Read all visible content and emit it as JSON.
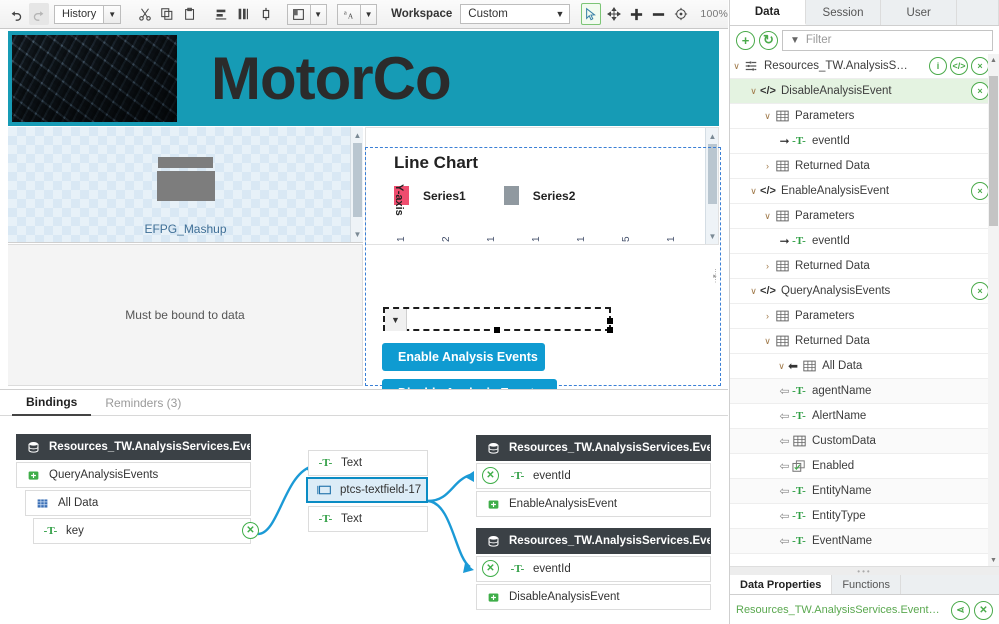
{
  "toolbar": {
    "undo": "undo-arrow",
    "redo": "redo-arrow",
    "history_label": "History",
    "cut": "scissors-icon",
    "copy": "copy-icon",
    "paste": "paste-icon",
    "align_h": "align-horizontal-icon",
    "align_v": "align-vertical-icon",
    "distribute": "distribute-icon",
    "layout": "layout-icon",
    "style": "style-text-icon",
    "workspace_label": "Workspace",
    "workspace_value": "Custom",
    "select_tool": "cursor-select-icon",
    "pan_tool": "pan-move-icon",
    "zoom_in": "plus-icon",
    "zoom_out": "minus-icon",
    "zoom_reset": "target-icon",
    "zoom_level": "100%"
  },
  "canvas": {
    "header_title": "MotorCo",
    "header_image": "engine-photo",
    "mashup_label": "EFPG_Mashup",
    "bound_placeholder": "Must be bound to data",
    "chart": {
      "title": "Line Chart",
      "legend": [
        {
          "label": "Series1",
          "color": "#ef4d6f"
        },
        {
          "label": "Series2",
          "color": "#9099a0"
        }
      ],
      "ylabel": "Y-axis",
      "xticks": [
        "1",
        "2",
        "1",
        "1",
        "1",
        "5",
        "1"
      ]
    },
    "dropdown_value": "",
    "buttons": [
      {
        "label": "Enable Analysis Events"
      },
      {
        "label": "Disable Analysis Events"
      }
    ]
  },
  "bindings": {
    "tabs": [
      {
        "label": "Bindings",
        "active": true
      },
      {
        "label": "Reminders (3)",
        "active": false
      }
    ],
    "left_group": [
      {
        "label": "Resources_TW.AnalysisServices.EventManagem...",
        "icon": "database-icon",
        "style": "dark"
      },
      {
        "label": "QueryAnalysisEvents",
        "icon": "service-icon",
        "style": "plain"
      },
      {
        "label": "All Data",
        "icon": "table-icon",
        "style": "plain"
      },
      {
        "label": "key",
        "icon": "text-type-icon",
        "style": "plain"
      }
    ],
    "middle_group": [
      {
        "label": "Text",
        "icon": "text-type-icon",
        "style": "plain"
      },
      {
        "label": "ptcs-textfield-17",
        "icon": "textfield-icon",
        "style": "sel"
      },
      {
        "label": "Text",
        "icon": "text-type-icon",
        "style": "plain"
      }
    ],
    "right_group_1": [
      {
        "label": "Resources_TW.AnalysisServices.EventManagem...",
        "icon": "database-icon",
        "style": "dark"
      },
      {
        "label": "eventId",
        "icon": "text-type-icon",
        "style": "plain"
      },
      {
        "label": "EnableAnalysisEvent",
        "icon": "service-icon",
        "style": "plain"
      }
    ],
    "right_group_2": [
      {
        "label": "Resources_TW.AnalysisServices.EventManagem...",
        "icon": "database-icon",
        "style": "dark"
      },
      {
        "label": "eventId",
        "icon": "text-type-icon",
        "style": "plain"
      },
      {
        "label": "DisableAnalysisEvent",
        "icon": "service-icon",
        "style": "plain"
      }
    ]
  },
  "right_panel": {
    "tabs": [
      {
        "label": "Data",
        "active": true
      },
      {
        "label": "Session",
        "active": false
      },
      {
        "label": "User",
        "active": false
      }
    ],
    "add_button": "+",
    "refresh_button": "↻",
    "filter_placeholder": "Filter",
    "tree": [
      {
        "indent": 0,
        "twist": "∨",
        "icon": "entity-icon",
        "label": "Resources_TW.AnalysisServi...",
        "actions": [
          "i",
          "</>",
          "×"
        ],
        "hl": false
      },
      {
        "indent": 1,
        "twist": "∨",
        "icon": "service-code-icon",
        "label": "DisableAnalysisEvent",
        "actions": [
          "×"
        ],
        "hl": true
      },
      {
        "indent": 2,
        "twist": "∨",
        "icon": "table-icon",
        "label": "Parameters",
        "actions": [],
        "hl": false
      },
      {
        "indent": 3,
        "twist": "→",
        "icon": "text-type-icon",
        "label": "eventId",
        "actions": [],
        "hl": false
      },
      {
        "indent": 2,
        "twist": "›",
        "icon": "table-icon",
        "label": "Returned Data",
        "actions": [],
        "hl": false
      },
      {
        "indent": 1,
        "twist": "∨",
        "icon": "service-code-icon",
        "label": "EnableAnalysisEvent",
        "actions": [
          "×"
        ],
        "hl": false
      },
      {
        "indent": 2,
        "twist": "∨",
        "icon": "table-icon",
        "label": "Parameters",
        "actions": [],
        "hl": false
      },
      {
        "indent": 3,
        "twist": "→",
        "icon": "text-type-icon",
        "label": "eventId",
        "actions": [],
        "hl": false
      },
      {
        "indent": 2,
        "twist": "›",
        "icon": "table-icon",
        "label": "Returned Data",
        "actions": [],
        "hl": false
      },
      {
        "indent": 1,
        "twist": "∨",
        "icon": "service-code-icon",
        "label": "QueryAnalysisEvents",
        "actions": [
          "×"
        ],
        "hl": false
      },
      {
        "indent": 2,
        "twist": "›",
        "icon": "table-icon",
        "label": "Parameters",
        "actions": [],
        "hl": false
      },
      {
        "indent": 2,
        "twist": "∨",
        "icon": "table-icon",
        "label": "Returned Data",
        "actions": [],
        "hl": false
      },
      {
        "indent": 3,
        "twist": "∨",
        "icon": "table-icon",
        "label": "All Data",
        "actions": [],
        "hl": false,
        "arrow": "←"
      },
      {
        "indent": 4,
        "twist": "⇐",
        "icon": "text-type-icon",
        "label": "agentName",
        "actions": [],
        "hl": false
      },
      {
        "indent": 4,
        "twist": "⇐",
        "icon": "text-type-icon",
        "label": "AlertName",
        "actions": [],
        "hl": false
      },
      {
        "indent": 4,
        "twist": "⇐",
        "icon": "table-icon",
        "label": "CustomData",
        "actions": [],
        "hl": false
      },
      {
        "indent": 4,
        "twist": "⇐",
        "icon": "boolean-icon",
        "label": "Enabled",
        "actions": [],
        "hl": false
      },
      {
        "indent": 4,
        "twist": "⇐",
        "icon": "text-type-icon",
        "label": "EntityName",
        "actions": [],
        "hl": false
      },
      {
        "indent": 4,
        "twist": "⇐",
        "icon": "text-type-icon",
        "label": "EntityType",
        "actions": [],
        "hl": false
      },
      {
        "indent": 4,
        "twist": "⇐",
        "icon": "text-type-icon",
        "label": "EventName",
        "actions": [],
        "hl": false
      }
    ],
    "bottom_tabs": [
      {
        "label": "Data Properties",
        "active": true
      },
      {
        "label": "Functions",
        "active": false
      }
    ],
    "property_label": "Resources_TW.AnalysisServices.EventMana...",
    "property_actions": [
      "share-icon",
      "close-icon"
    ]
  },
  "colors": {
    "brand_teal": "#169bb5",
    "button_blue": "#0f9bd1",
    "accent_green": "#4aaa4a",
    "selection_blue": "#0a8cc4",
    "link_blue": "#1b9ad6"
  }
}
